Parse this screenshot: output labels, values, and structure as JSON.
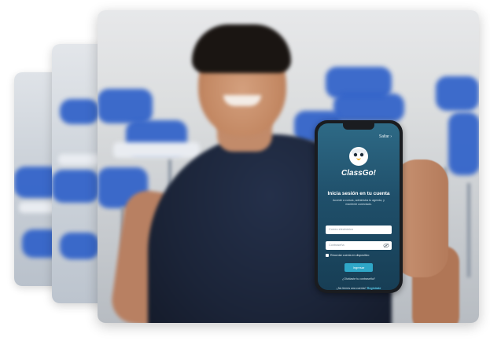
{
  "app": {
    "skip_label": "Saltar",
    "brand_name": "ClassGo!",
    "login_title": "Inicia sesión en tu cuenta",
    "login_subtitle": "Accede a cursos, administra tu agenda, y mantente conectado.",
    "email_placeholder": "Correo electrónico",
    "password_placeholder": "Contraseña",
    "remember_label": "Recordar cuenta en dispositivo",
    "submit_label": "Ingresar",
    "forgot_label": "¿Olvidaste tu contraseña?",
    "signup_prompt": "¿No tienes una cuenta?",
    "signup_link": "Registrate"
  },
  "colors": {
    "screen_top": "#2e6a86",
    "screen_bottom": "#173e55",
    "button": "#2fa7c8",
    "link": "#5fd0ee",
    "chairs": "#2f61c9"
  },
  "icons": {
    "logo": "eagle-mascot-icon",
    "skip": "chevron-right-icon",
    "password_toggle": "eye-off-icon"
  }
}
